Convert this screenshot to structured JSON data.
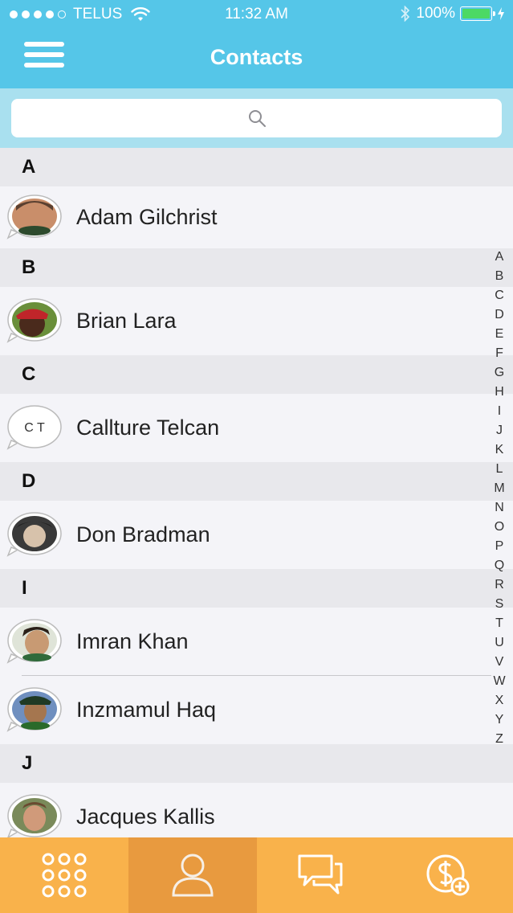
{
  "status_bar": {
    "carrier": "TELUS",
    "time": "11:32 AM",
    "battery": "100%"
  },
  "header": {
    "title": "Contacts"
  },
  "search": {
    "placeholder": ""
  },
  "sections": [
    {
      "letter": "A",
      "contacts": [
        {
          "name": "Adam Gilchrist",
          "avatar": "photo"
        }
      ]
    },
    {
      "letter": "B",
      "contacts": [
        {
          "name": "Brian Lara",
          "avatar": "photo"
        }
      ]
    },
    {
      "letter": "C",
      "contacts": [
        {
          "name": "Callture Telcan",
          "avatar": "initials",
          "initials": "C T"
        }
      ]
    },
    {
      "letter": "D",
      "contacts": [
        {
          "name": "Don Bradman",
          "avatar": "photo"
        }
      ]
    },
    {
      "letter": "I",
      "contacts": [
        {
          "name": "Imran Khan",
          "avatar": "photo"
        },
        {
          "name": "Inzmamul Haq",
          "avatar": "photo"
        }
      ]
    },
    {
      "letter": "J",
      "contacts": [
        {
          "name": "Jacques Kallis",
          "avatar": "photo"
        }
      ]
    }
  ],
  "index_letters": [
    "A",
    "B",
    "C",
    "D",
    "E",
    "F",
    "G",
    "H",
    "I",
    "J",
    "K",
    "L",
    "M",
    "N",
    "O",
    "P",
    "Q",
    "R",
    "S",
    "T",
    "U",
    "V",
    "W",
    "X",
    "Y",
    "Z"
  ],
  "tabs": [
    {
      "icon": "dialpad-icon",
      "active": false
    },
    {
      "icon": "contacts-icon",
      "active": true
    },
    {
      "icon": "messages-icon",
      "active": false
    },
    {
      "icon": "add-credit-icon",
      "active": false
    }
  ],
  "colors": {
    "header": "#55c6e8",
    "search_bg": "#a9e0ef",
    "tabbar": "#f9b24b",
    "tab_active": "#e89a3f"
  }
}
